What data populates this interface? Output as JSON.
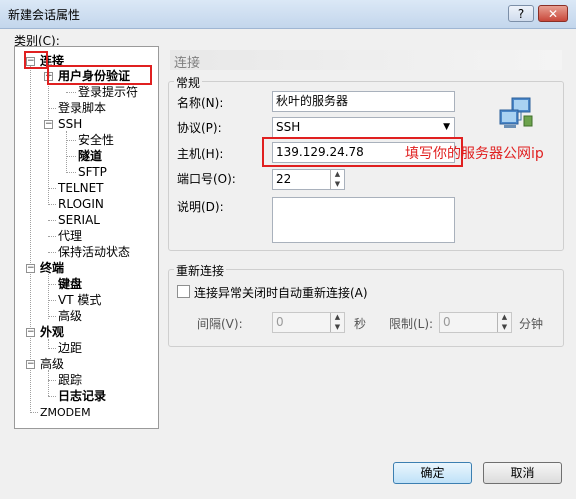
{
  "window": {
    "title": "新建会话属性",
    "help": "?",
    "close": "✕"
  },
  "category": {
    "label": "类别(C):"
  },
  "tree": {
    "connection": "连接",
    "user_auth": "用户身份验证",
    "login_prompt": "登录提示符",
    "login_script": "登录脚本",
    "ssh": "SSH",
    "security": "安全性",
    "tunnel": "隧道",
    "sftp": "SFTP",
    "telnet": "TELNET",
    "rlogin": "RLOGIN",
    "serial": "SERIAL",
    "proxy": "代理",
    "keepalive": "保持活动状态",
    "terminal": "终端",
    "keyboard": "键盘",
    "vt_mode": "VT 模式",
    "term_advanced": "高级",
    "appearance": "外观",
    "margin": "边距",
    "advanced": "高级",
    "trace": "跟踪",
    "log": "日志记录",
    "zmodem": "ZMODEM",
    "minus": "−",
    "plus": "+"
  },
  "panel": {
    "header": "连接",
    "general_label": "常规",
    "name_label": "名称(N):",
    "name_value": "秋叶的服务器",
    "protocol_label": "协议(P):",
    "protocol_value": "SSH",
    "host_label": "主机(H):",
    "host_value": "139.129.24.78",
    "port_label": "端口号(O):",
    "port_value": "22",
    "desc_label": "说明(D):",
    "desc_value": "",
    "annotation": "填写你的服务器公网ip"
  },
  "reconnect": {
    "label": "重新连接",
    "checkbox_label": "连接异常关闭时自动重新连接(A)",
    "interval_label": "间隔(V):",
    "interval_value": "0",
    "seconds": "秒",
    "limit_label": "限制(L):",
    "limit_value": "0",
    "minutes": "分钟"
  },
  "buttons": {
    "ok": "确定",
    "cancel": "取消"
  },
  "icons": {
    "up": "▲",
    "down": "▼",
    "dropdown": "▼"
  }
}
